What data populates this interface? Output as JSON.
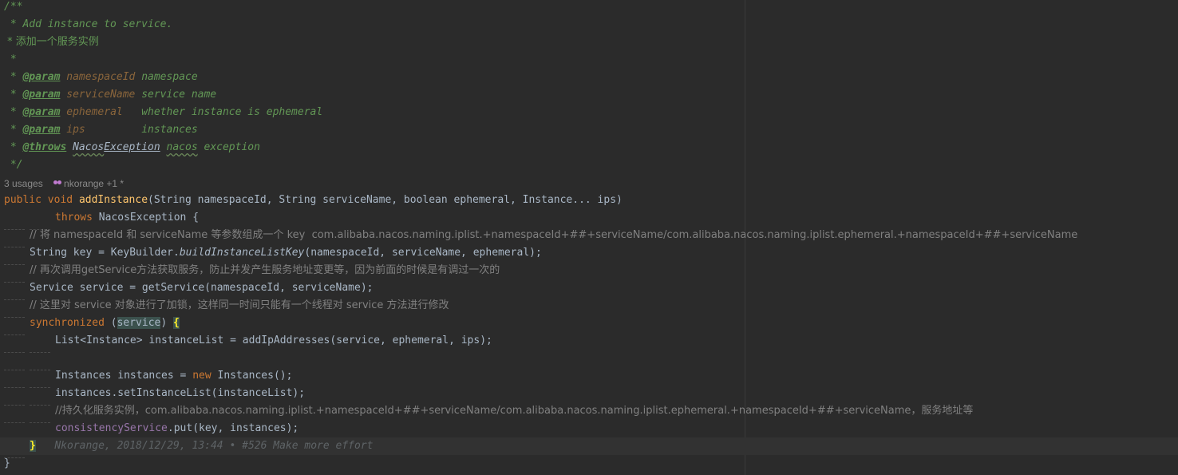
{
  "doc": {
    "open": "/**",
    "summary": " * Add instance to service.",
    "summary_cn": " * 添加一个服务实例",
    "blank": " *",
    "star": " * ",
    "param_tag": "@param",
    "throws_tag": "@throws",
    "params": [
      {
        "name": "namespaceId",
        "pad": " ",
        "desc": "namespace"
      },
      {
        "name": "serviceName",
        "pad": " ",
        "desc": "service name"
      },
      {
        "name": "ephemeral",
        "pad": "   ",
        "desc": "whether instance is ephemeral"
      },
      {
        "name": "ips",
        "pad": "         ",
        "desc": "instances"
      }
    ],
    "throws_type_a": "Nacos",
    "throws_type_b": "Exception",
    "throws_desc_a": "nacos",
    "throws_desc_b": " exception",
    "close": " */"
  },
  "meta": {
    "usages": "3 usages",
    "author": "nkorange +1 *"
  },
  "code": {
    "sig_public": "public",
    "sig_void": "void",
    "sig_name": "addInstance",
    "sig_params": "(String namespaceId, String serviceName, boolean ephemeral, Instance... ips)",
    "throws_kw": "throws",
    "throws_rest": " NacosException {",
    "c1": "// 将 namespaceId 和 serviceName 等参数组成一个 key  com.alibaba.nacos.naming.iplist.+namespaceId+##+serviceName/com.alibaba.nacos.naming.iplist.ephemeral.+namespaceId+##+serviceName",
    "l1a": "String key = KeyBuilder.",
    "l1b": "buildInstanceListKey",
    "l1c": "(namespaceId, serviceName, ephemeral);",
    "c2": "// 再次调用getService方法获取服务，防止并发产生服务地址变更等，因为前面的时候是有调过一次的",
    "l2": "Service service = getService(namespaceId, serviceName);",
    "c3": "// 这里对 service 对象进行了加锁，这样同一时间只能有一个线程对 service 方法进行修改",
    "sync_kw": "synchronized",
    "sync_open": " (",
    "sync_var": "service",
    "sync_close": ") ",
    "sync_brace": "{",
    "l3": "List<Instance> instanceList = addIpAddresses(service, ephemeral, ips);",
    "l4a": "Instances instances = ",
    "l4b": "new",
    "l4c": " Instances();",
    "l5": "instances.setInstanceList(instanceList);",
    "c4": "//持久化服务实例，com.alibaba.nacos.naming.iplist.+namespaceId+##+serviceName/com.alibaba.nacos.naming.iplist.ephemeral.+namespaceId+##+serviceName，服务地址等",
    "l6a": "consistencyService",
    "l6b": ".put(key, instances);",
    "close_brace": "}",
    "blame": "Nkorange, 2018/12/29, 13:44 • #526 Make more effort",
    "end_brace": "}"
  }
}
